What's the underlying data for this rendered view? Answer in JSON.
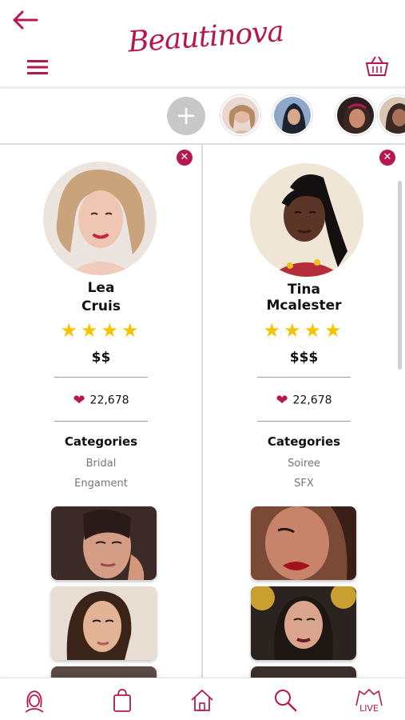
{
  "header": {
    "logo_text": "Beautinova",
    "back_icon": "arrow-left-icon",
    "menu_icon": "hamburger-icon",
    "cart_icon": "basket-icon"
  },
  "strip": {
    "add_label": "+",
    "thumbnails": [
      "artist-1",
      "artist-2",
      "artist-3",
      "artist-4"
    ]
  },
  "artists": [
    {
      "first": "Lea",
      "last": "Cruis",
      "rating": 4,
      "stars": "★★★★",
      "price": "$$",
      "likes": "22,678",
      "categories_title": "Categories",
      "categories": [
        "Bridal",
        "Engament"
      ]
    },
    {
      "first": "Tina",
      "last": "Mcalester",
      "rating": 4,
      "stars": "★★★★",
      "price": "$$$",
      "likes": "22,678",
      "categories_title": "Categories",
      "categories": [
        "Soiree",
        "SFX"
      ]
    }
  ],
  "bottom_nav": [
    "profile-icon",
    "shopping-bag-icon",
    "home-icon",
    "search-icon",
    "live-icon"
  ],
  "colors": {
    "brand": "#b5174f",
    "star": "#f5c400"
  }
}
